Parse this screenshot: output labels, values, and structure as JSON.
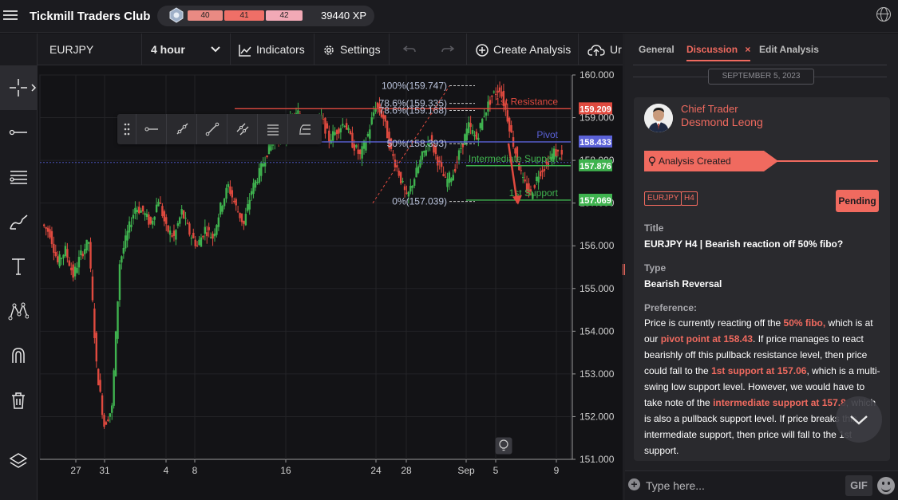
{
  "app": {
    "brand": "Tickmill Traders Club",
    "xp_segments": [
      "40",
      "41",
      "42"
    ],
    "xp_total": "39440 XP"
  },
  "toolbar": {
    "symbol": "EURJPY",
    "timeframe": "4 hour",
    "indicators": "Indicators",
    "settings": "Settings",
    "create_analysis": "Create Analysis",
    "upload": "Ur"
  },
  "left_tools": [
    "crosshair-icon",
    "line-tool-icon",
    "fib-tool-icon",
    "brush-icon",
    "text-tool-icon",
    "pattern-icon",
    "magnet-icon",
    "trash-icon",
    "layers-icon"
  ],
  "chart_data": {
    "type": "line",
    "symbol": "EURJPY",
    "timeframe": "4 hour",
    "ylim": [
      151.0,
      160.0
    ],
    "y_ticks": [
      "160.000",
      "159.000",
      "158.000",
      "157.000",
      "156.000",
      "155.000",
      "154.000",
      "153.000",
      "152.000",
      "151.000"
    ],
    "x_ticks": [
      "27",
      "31",
      "4",
      "8",
      "16",
      "24",
      "28",
      "Sep",
      "5",
      "9"
    ],
    "price_series": [
      156.5,
      156.3,
      155.6,
      155.9,
      155.3,
      155.8,
      156.1,
      153.2,
      151.8,
      152.2,
      155.6,
      156.3,
      156.9,
      156.8,
      156.5,
      157.1,
      156.4,
      156.2,
      156.8,
      156.3,
      156.0,
      156.4,
      156.2,
      156.9,
      157.4,
      156.9,
      156.5,
      157.3,
      157.7,
      158.2,
      158.6,
      158.4,
      158.9,
      159.1,
      158.6,
      158.8,
      159.0,
      158.5,
      158.7,
      158.9,
      158.4,
      158.1,
      158.6,
      159.3,
      159.0,
      158.2,
      157.7,
      157.1,
      157.6,
      158.1,
      158.5,
      158.0,
      157.5,
      157.7,
      158.3,
      158.8,
      158.5,
      159.1,
      159.5,
      159.7,
      159.0,
      158.2,
      157.5,
      157.2,
      157.7,
      157.9,
      158.2,
      158.1
    ],
    "levels": [
      {
        "name": "1st Resistance",
        "value": 159.209,
        "label": "159.209",
        "color": "#e04a3f"
      },
      {
        "name": "Pivot",
        "value": 158.433,
        "label": "158.433",
        "color": "#5b62d8"
      },
      {
        "name": "Intermediate Support",
        "value": 157.876,
        "label": "157.876",
        "color": "#3fb34f"
      },
      {
        "name": "1st Support",
        "value": 157.069,
        "label": "157.069",
        "color": "#3fb34f"
      }
    ],
    "fib_levels": [
      {
        "label": "100%(159.747)",
        "value": 159.747
      },
      {
        "label": "78.6%(159.335)",
        "value": 159.335
      },
      {
        "label": "78.6%(159.168)",
        "value": 159.168
      },
      {
        "label": "50%(158.393)",
        "value": 158.393
      },
      {
        "label": "0%(157.039)",
        "value": 157.039
      }
    ],
    "projection": {
      "from": 158.4,
      "to": 157.0
    },
    "grid": true
  },
  "panel": {
    "tabs": [
      "General",
      "Discussion",
      "Edit Analysis"
    ],
    "active_tab_close": "×",
    "date": "SEPTEMBER 5, 2023",
    "author_role": "Chief Trader",
    "author_name": "Desmond Leong",
    "status_event": "Analysis Created",
    "tags": [
      "EURJPY",
      "H4"
    ],
    "status": "Pending",
    "title_label": "Title",
    "title": "EURJPY H4 | Bearish reaction off 50% fibo?",
    "type_label": "Type",
    "type": "Bearish Reversal",
    "preference_label": "Preference:",
    "preference_parts": [
      {
        "t": "Price is currently reacting off the ",
        "h": false
      },
      {
        "t": "50% fibo,",
        "h": true
      },
      {
        "t": " which is at our ",
        "h": false
      },
      {
        "t": "pivot point at 158.43",
        "h": true
      },
      {
        "t": ". If price manages to react bearishly off this pullback resistance level, then price could fall to the ",
        "h": false
      },
      {
        "t": "1st support at 157.06",
        "h": true
      },
      {
        "t": ", which is a multi-swing low support level. However, we would have to take note of the ",
        "h": false
      },
      {
        "t": "intermediate support at 157.8",
        "h": true
      },
      {
        "t": "",
        "h": false
      },
      {
        "t": ", which is also a pullback support level. If price breaks this intermediate support, then price will fall to the 1st support.",
        "h": false
      }
    ]
  },
  "comment": {
    "placeholder": "Type here...",
    "gif": "GIF"
  }
}
